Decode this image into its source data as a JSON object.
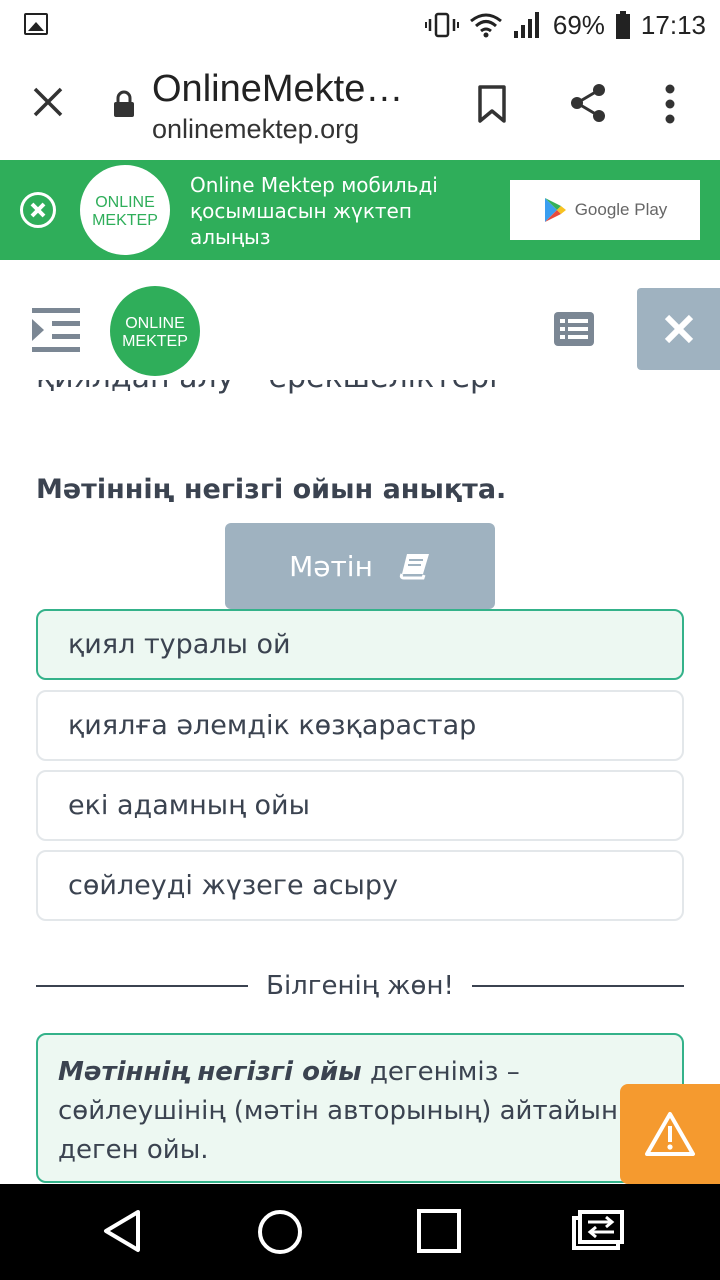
{
  "status_bar": {
    "battery": "69%",
    "time": "17:13"
  },
  "browser": {
    "title": "OnlineMekte…",
    "url": "onlinemektep.org"
  },
  "app_banner": {
    "message": "Online Mektep мобильді қосымшасын жүктеп алыңыз",
    "store_button": "Google Play",
    "logo_line1": "ONLINE",
    "logo_line2": "MEKTEP"
  },
  "app_header": {
    "logo_line1": "ONLINE",
    "logo_line2": "MEKTEP"
  },
  "content": {
    "clipped_text": "қиялдан алу – ерекшеліктері",
    "question": "Мәтіннің негізгі ойын анықта.",
    "text_button": "Мәтін",
    "options": [
      {
        "label": "қиял туралы ой",
        "selected": true
      },
      {
        "label": "қиялға әлемдік көзқарастар",
        "selected": false
      },
      {
        "label": "екі адамның ойы",
        "selected": false
      },
      {
        "label": "сөйлеуді жүзеге асыру",
        "selected": false
      }
    ],
    "divider_label": "Білгенің жөн!",
    "info": {
      "term": "Мәтіннің негізгі ойы",
      "definition": " дегеніміз – сөйлеушінің (мәтін авторының) айтайын деген ойы."
    }
  },
  "colors": {
    "green": "#2fae5a",
    "teal_border": "#34b28a",
    "gray_button": "#9fb2c0",
    "warning": "#f59a2f"
  }
}
